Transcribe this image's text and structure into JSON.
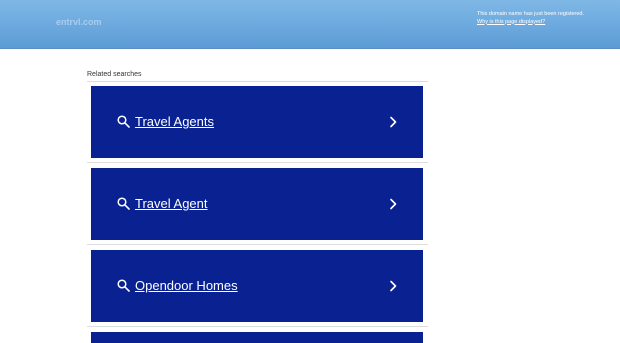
{
  "header": {
    "domain": "entrvl.com",
    "notice_text": "This domain name has just been registered.",
    "notice_link": "Why is this page displayed?"
  },
  "related": {
    "title": "Related searches",
    "items": [
      {
        "label": "Travel Agents",
        "icon": "search-icon",
        "arrow": "chevron-right-icon"
      },
      {
        "label": "Travel Agent",
        "icon": "search-icon",
        "arrow": "chevron-right-icon"
      },
      {
        "label": "Opendoor Homes",
        "icon": "search-icon",
        "arrow": "chevron-right-icon"
      }
    ]
  },
  "colors": {
    "header_bg": "#6aa7dd",
    "result_bg": "#0a2291",
    "result_text": "#ffffff"
  }
}
